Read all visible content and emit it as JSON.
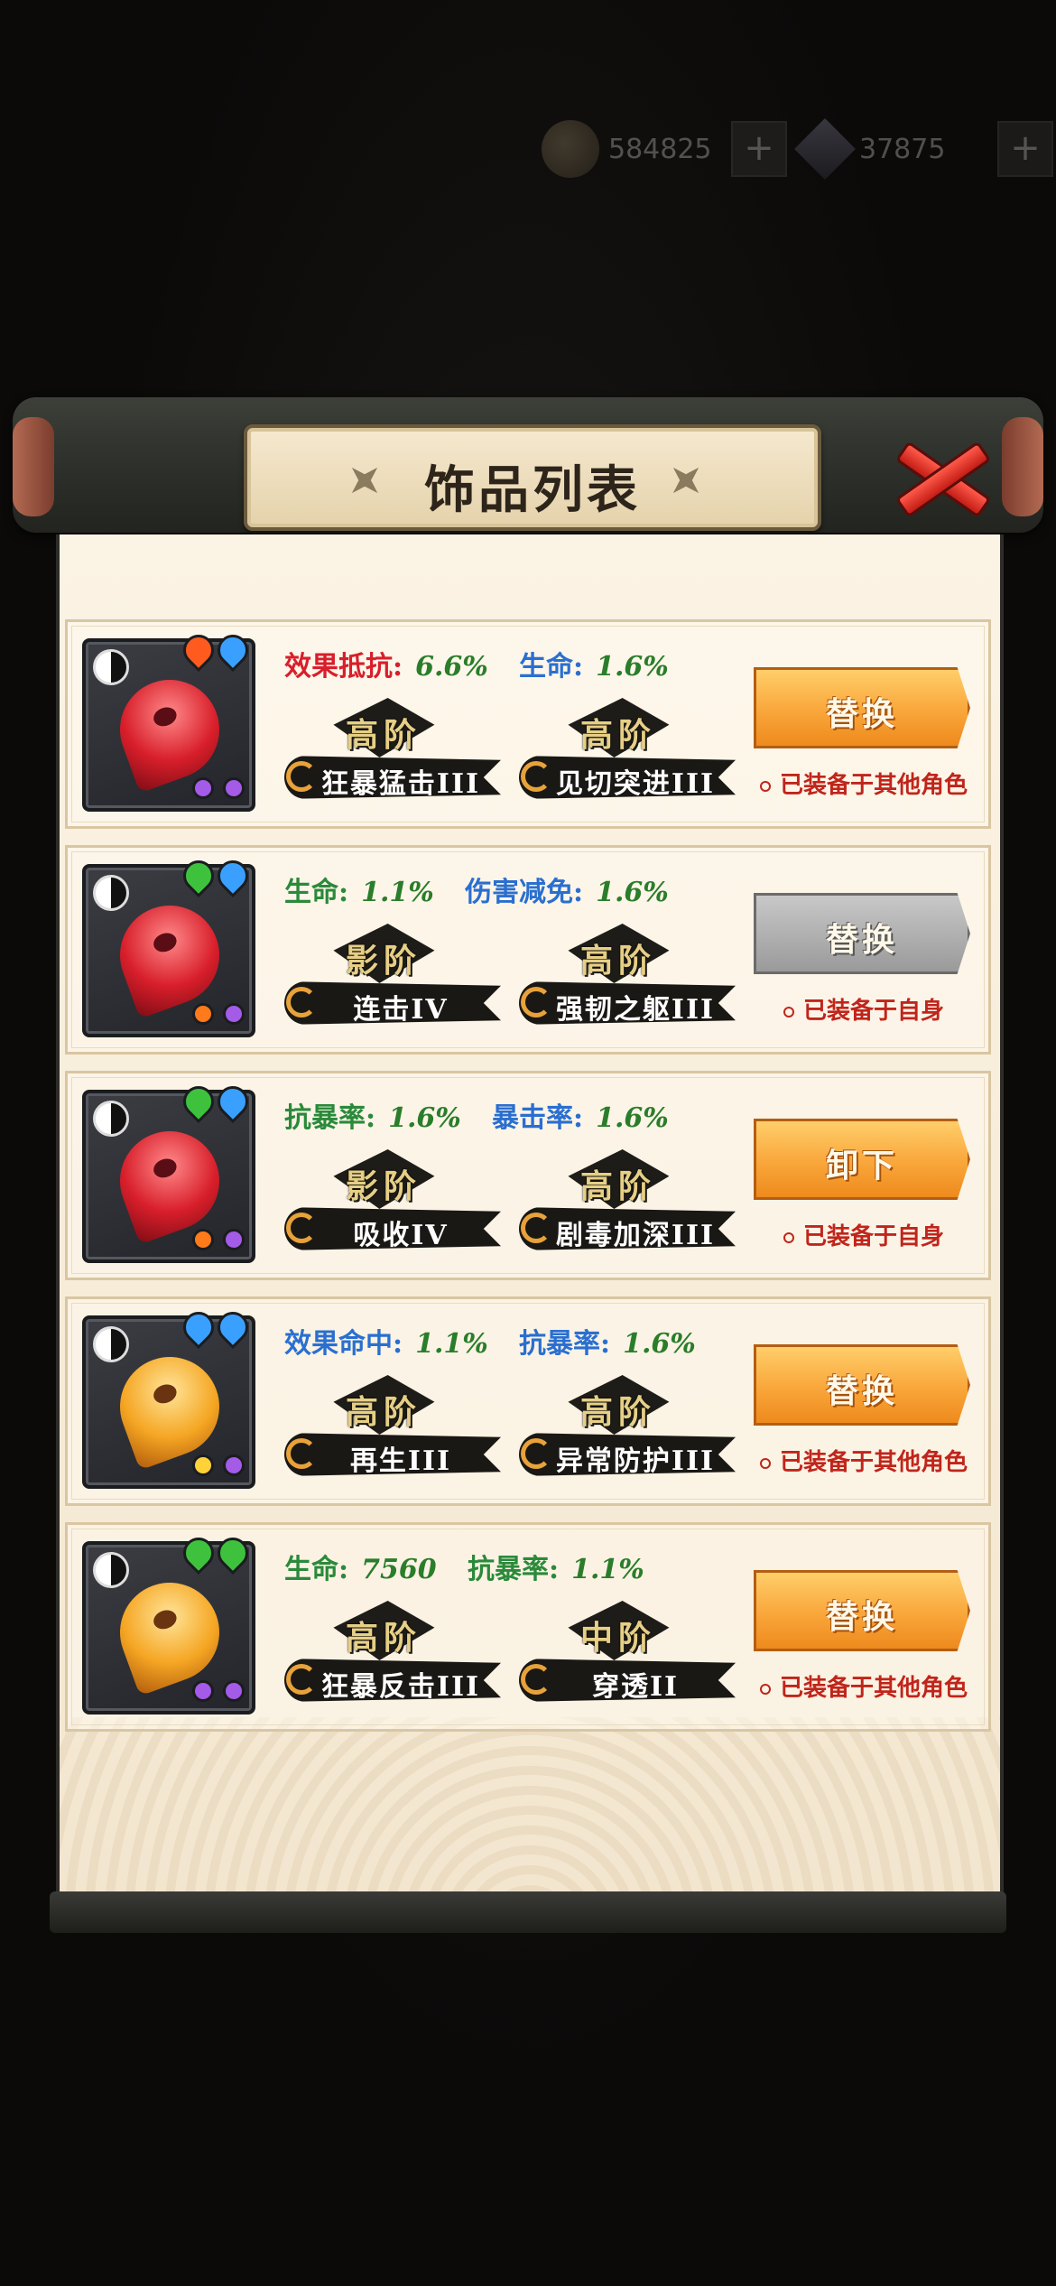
{
  "currency": {
    "coins": "584825",
    "gems": "37875",
    "plus": "+"
  },
  "panel": {
    "title": "饰品列表"
  },
  "colors": {
    "red": "#d81f2b",
    "blue": "#2a6fd0",
    "green": "#2a8a3a",
    "orange_button": "#f9a63a",
    "gray_button": "#9a9a9a",
    "note_red": "#c0251b"
  },
  "items": [
    {
      "orb": "red",
      "flames": [
        "#ff5b1f",
        "#3aa0ff"
      ],
      "dots": [
        "#a45be8",
        "#a45be8"
      ],
      "stat1": {
        "label": "效果抵抗:",
        "value": "6.6%",
        "color": "#d81f2b"
      },
      "stat2": {
        "label": "生命:",
        "value": "1.6%",
        "color": "#2a6fd0"
      },
      "skill1": {
        "rank": "高阶",
        "name": "狂暴猛击III"
      },
      "skill2": {
        "rank": "高阶",
        "name": "见切突进III"
      },
      "button": "替换",
      "button_style": "orange",
      "note": "已装备于其他角色"
    },
    {
      "orb": "red",
      "flames": [
        "#3ec23e",
        "#3aa0ff"
      ],
      "dots": [
        "#ff7a1a",
        "#a45be8"
      ],
      "stat1": {
        "label": "生命:",
        "value": "1.1%",
        "color": "#2a8a3a"
      },
      "stat2": {
        "label": "伤害减免:",
        "value": "1.6%",
        "color": "#2a6fd0"
      },
      "skill1": {
        "rank": "影阶",
        "name": "连击IV"
      },
      "skill2": {
        "rank": "高阶",
        "name": "强韧之躯III"
      },
      "button": "替换",
      "button_style": "gray",
      "note": "已装备于自身"
    },
    {
      "orb": "red",
      "flames": [
        "#3ec23e",
        "#3aa0ff"
      ],
      "dots": [
        "#ff7a1a",
        "#a45be8"
      ],
      "stat1": {
        "label": "抗暴率:",
        "value": "1.6%",
        "color": "#2a8a3a"
      },
      "stat2": {
        "label": "暴击率:",
        "value": "1.6%",
        "color": "#2a6fd0"
      },
      "skill1": {
        "rank": "影阶",
        "name": "吸收IV"
      },
      "skill2": {
        "rank": "高阶",
        "name": "剧毒加深III"
      },
      "button": "卸下",
      "button_style": "orange",
      "note": "已装备于自身"
    },
    {
      "orb": "orange",
      "flames": [
        "#3aa0ff",
        "#3aa0ff"
      ],
      "dots": [
        "#ffd23a",
        "#a45be8"
      ],
      "stat1": {
        "label": "效果命中:",
        "value": "1.1%",
        "color": "#2a6fd0"
      },
      "stat2": {
        "label": "抗暴率:",
        "value": "1.6%",
        "color": "#2a6fd0"
      },
      "skill1": {
        "rank": "高阶",
        "name": "再生III"
      },
      "skill2": {
        "rank": "高阶",
        "name": "异常防护III"
      },
      "button": "替换",
      "button_style": "orange",
      "note": "已装备于其他角色"
    },
    {
      "orb": "orange",
      "flames": [
        "#3ec23e",
        "#3ec23e"
      ],
      "dots": [
        "#a45be8",
        "#a45be8"
      ],
      "stat1": {
        "label": "生命:",
        "value": "7560",
        "color": "#2a8a3a"
      },
      "stat2": {
        "label": "抗暴率:",
        "value": "1.1%",
        "color": "#2a8a3a"
      },
      "skill1": {
        "rank": "高阶",
        "name": "狂暴反击III"
      },
      "skill2": {
        "rank": "中阶",
        "name": "穿透II"
      },
      "button": "替换",
      "button_style": "orange",
      "note": "已装备于其他角色"
    }
  ]
}
